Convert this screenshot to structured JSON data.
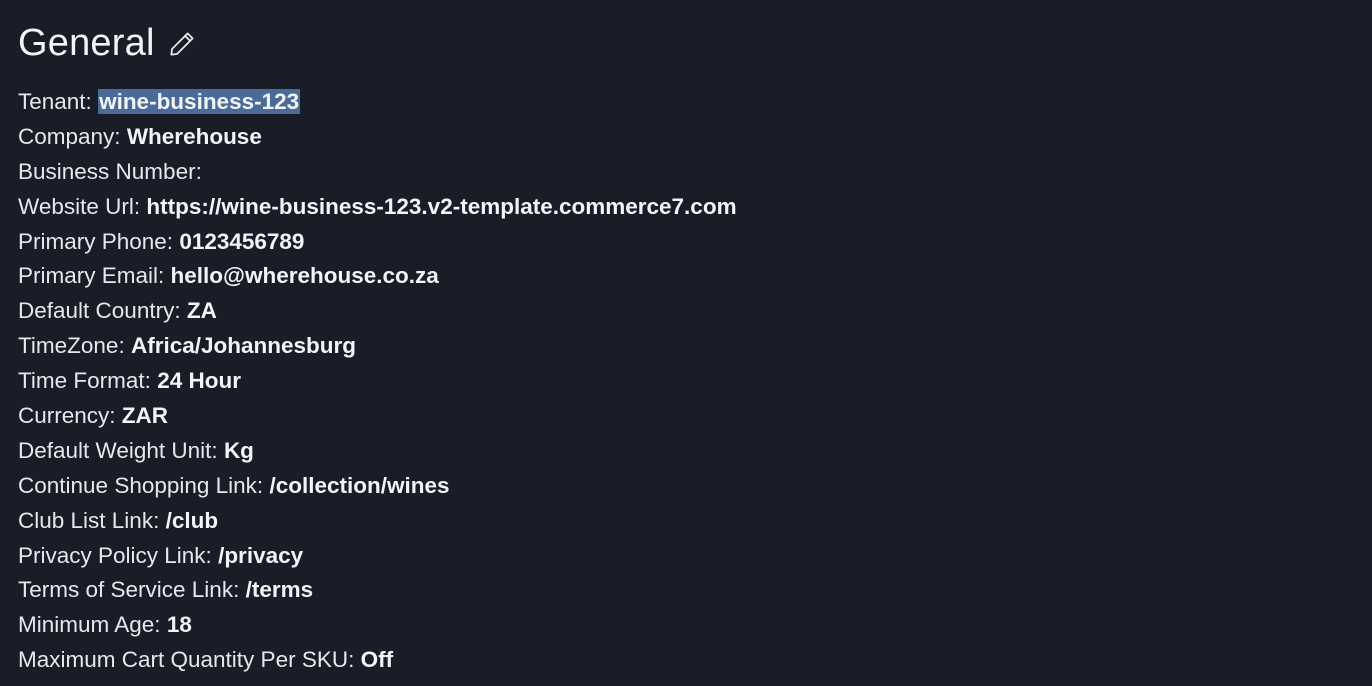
{
  "section": {
    "title": "General",
    "edit_icon": "pencil-icon"
  },
  "fields": [
    {
      "label": "Tenant: ",
      "value": "wine-business-123",
      "selected": true
    },
    {
      "label": "Company: ",
      "value": "Wherehouse"
    },
    {
      "label": "Business Number: ",
      "value": ""
    },
    {
      "label": "Website Url: ",
      "value": "https://wine-business-123.v2-template.commerce7.com"
    },
    {
      "label": "Primary Phone: ",
      "value": "0123456789"
    },
    {
      "label": "Primary Email: ",
      "value": "hello@wherehouse.co.za"
    },
    {
      "label": "Default Country: ",
      "value": "ZA"
    },
    {
      "label": "TimeZone: ",
      "value": "Africa/Johannesburg"
    },
    {
      "label": "Time Format: ",
      "value": "24 Hour"
    },
    {
      "label": "Currency: ",
      "value": "ZAR"
    },
    {
      "label": "Default Weight Unit: ",
      "value": "Kg"
    },
    {
      "label": "Continue Shopping Link: ",
      "value": "/collection/wines"
    },
    {
      "label": "Club List Link: ",
      "value": "/club"
    },
    {
      "label": "Privacy Policy Link: ",
      "value": "/privacy"
    },
    {
      "label": "Terms of Service Link: ",
      "value": "/terms"
    },
    {
      "label": "Minimum Age: ",
      "value": "18"
    },
    {
      "label": "Maximum Cart Quantity Per SKU: ",
      "value": "Off"
    }
  ],
  "colors": {
    "background": "#181d28",
    "text": "#e6e8ec",
    "selection": "#4a6b9a"
  }
}
